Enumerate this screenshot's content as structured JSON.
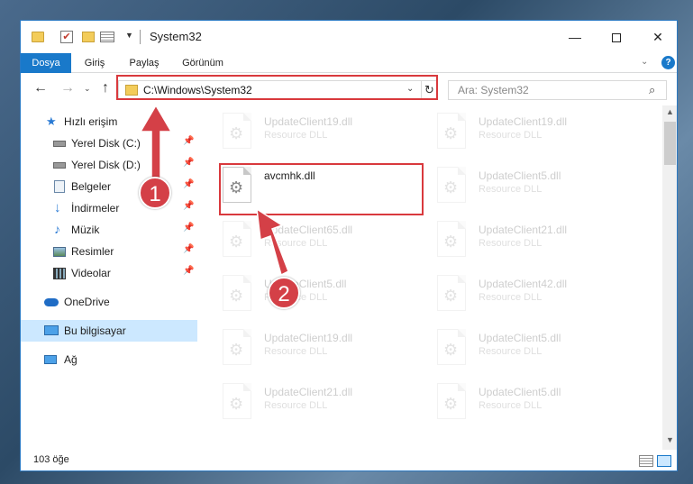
{
  "window": {
    "title": "System32",
    "controls": {
      "minimize": "—",
      "maximize": "",
      "close": "✕"
    }
  },
  "ribbon": {
    "tabs": [
      "Dosya",
      "Giriş",
      "Paylaş",
      "Görünüm"
    ],
    "help": "?"
  },
  "navigation": {
    "address": "C:\\Windows\\System32",
    "search_placeholder": "Ara: System32"
  },
  "sidebar": {
    "items": [
      {
        "label": "Hızlı erişim",
        "icon": "star-icon",
        "pinned": false
      },
      {
        "label": "Yerel Disk (C:)",
        "icon": "drive-icon",
        "pinned": true
      },
      {
        "label": "Yerel Disk (D:)",
        "icon": "drive-icon",
        "pinned": true
      },
      {
        "label": "Belgeler",
        "icon": "documents-icon",
        "pinned": true
      },
      {
        "label": "İndirmeler",
        "icon": "download-icon",
        "pinned": true
      },
      {
        "label": "Müzik",
        "icon": "music-icon",
        "pinned": true
      },
      {
        "label": "Resimler",
        "icon": "pictures-icon",
        "pinned": true
      },
      {
        "label": "Videolar",
        "icon": "video-icon",
        "pinned": true
      },
      {
        "label": "OneDrive",
        "icon": "cloud-icon",
        "pinned": false
      },
      {
        "label": "Bu bilgisayar",
        "icon": "computer-icon",
        "pinned": false,
        "selected": true
      },
      {
        "label": "Ağ",
        "icon": "network-icon",
        "pinned": false
      }
    ]
  },
  "files": {
    "left_column": [
      {
        "name": "UpdateClient19.dll",
        "type": "Resource DLL"
      },
      {
        "name": "avcmhk.dll",
        "type": ""
      },
      {
        "name": "UpdateClient65.dll",
        "type": "Resource DLL"
      },
      {
        "name": "UpdateClient5.dll",
        "type": "Resource DLL"
      },
      {
        "name": "UpdateClient19.dll",
        "type": "Resource DLL"
      },
      {
        "name": "UpdateClient21.dll",
        "type": "Resource DLL"
      }
    ],
    "right_column": [
      {
        "name": "UpdateClient19.dll",
        "type": "Resource DLL"
      },
      {
        "name": "UpdateClient5.dll",
        "type": "Resource DLL"
      },
      {
        "name": "UpdateClient21.dll",
        "type": "Resource DLL"
      },
      {
        "name": "UpdateClient42.dll",
        "type": "Resource DLL"
      },
      {
        "name": "UpdateClient5.dll",
        "type": "Resource DLL"
      },
      {
        "name": "UpdateClient5.dll",
        "type": "Resource DLL"
      }
    ],
    "highlighted_file": "avcmhk.dll"
  },
  "status": {
    "item_count": "103 öğe"
  },
  "annotations": {
    "step1": "1",
    "step2": "2",
    "color": "#d44047"
  }
}
